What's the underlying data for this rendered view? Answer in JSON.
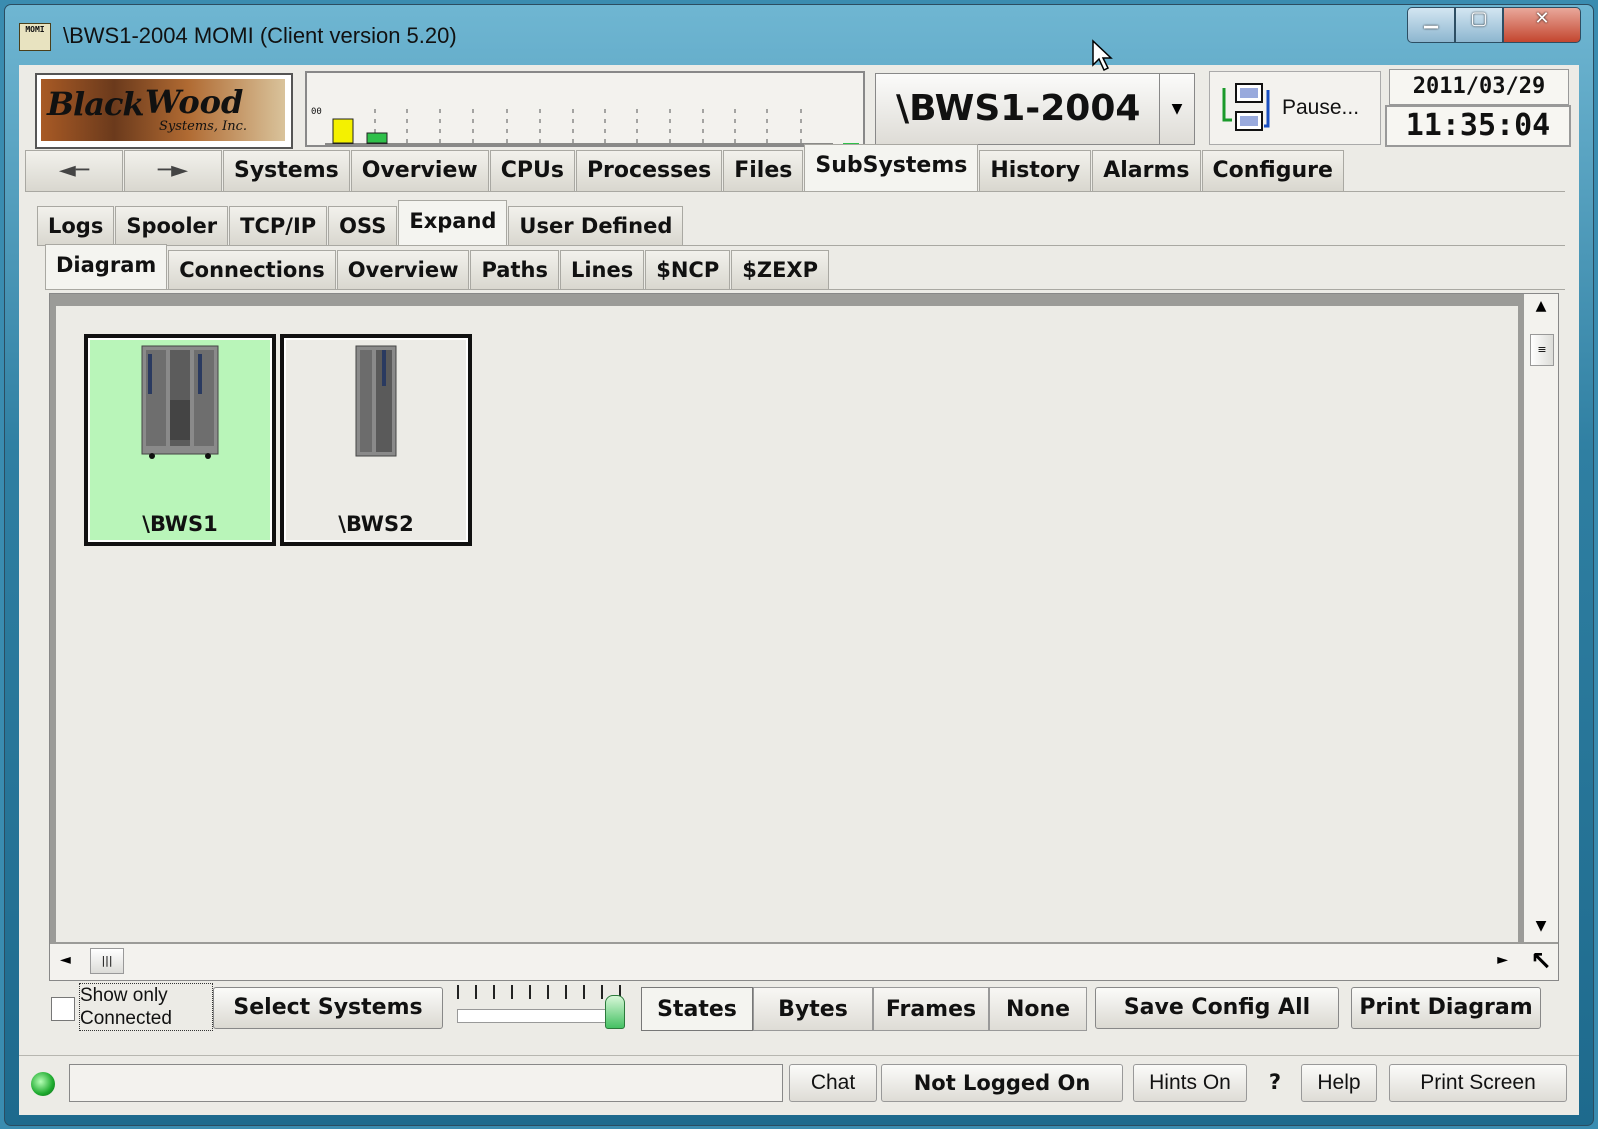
{
  "window": {
    "title": "\\BWS1-2004 MOMI (Client version 5.20)",
    "app_icon_text": "MOMI"
  },
  "header": {
    "logo": {
      "word1": "Black",
      "word2": "Wood",
      "word3": "Systems, Inc."
    },
    "graph_label": "00",
    "system_name": "\\BWS1-2004",
    "pause_label": "Pause...",
    "date": "2011/03/29",
    "time": "11:35:04"
  },
  "main_tabs": [
    "Systems",
    "Overview",
    "CPUs",
    "Processes",
    "Files",
    "SubSystems",
    "History",
    "Alarms",
    "Configure"
  ],
  "main_tab_active": "SubSystems",
  "sub_tabs": [
    "Logs",
    "Spooler",
    "TCP/IP",
    "OSS",
    "Expand",
    "User Defined"
  ],
  "sub_tab_active": "Expand",
  "expand_tabs": [
    "Diagram",
    "Connections",
    "Overview",
    "Paths",
    "Lines",
    "$NCP",
    "$ZEXP"
  ],
  "expand_tab_active": "Diagram",
  "nodes": [
    {
      "label": "\\BWS1",
      "state": "connected",
      "color": "#b9f5b9"
    },
    {
      "label": "\\BWS2",
      "state": "unknown",
      "color": "#ecebe6"
    }
  ],
  "bottom": {
    "show_only_connected": "Show only Connected",
    "select_systems": "Select Systems",
    "display_modes": [
      "States",
      "Bytes",
      "Frames",
      "None"
    ],
    "display_mode_active": "States",
    "save_config": "Save Config All",
    "print_diagram": "Print Diagram"
  },
  "statusbar": {
    "chat": "Chat",
    "login": "Not Logged On",
    "hints": "Hints On",
    "question": "?",
    "help": "Help",
    "print_screen": "Print Screen"
  },
  "colors": {
    "connected": "#b9f5b9",
    "led": "#1daa2e",
    "graph_yellow": "#f4f100",
    "graph_green": "#2fc04a"
  }
}
